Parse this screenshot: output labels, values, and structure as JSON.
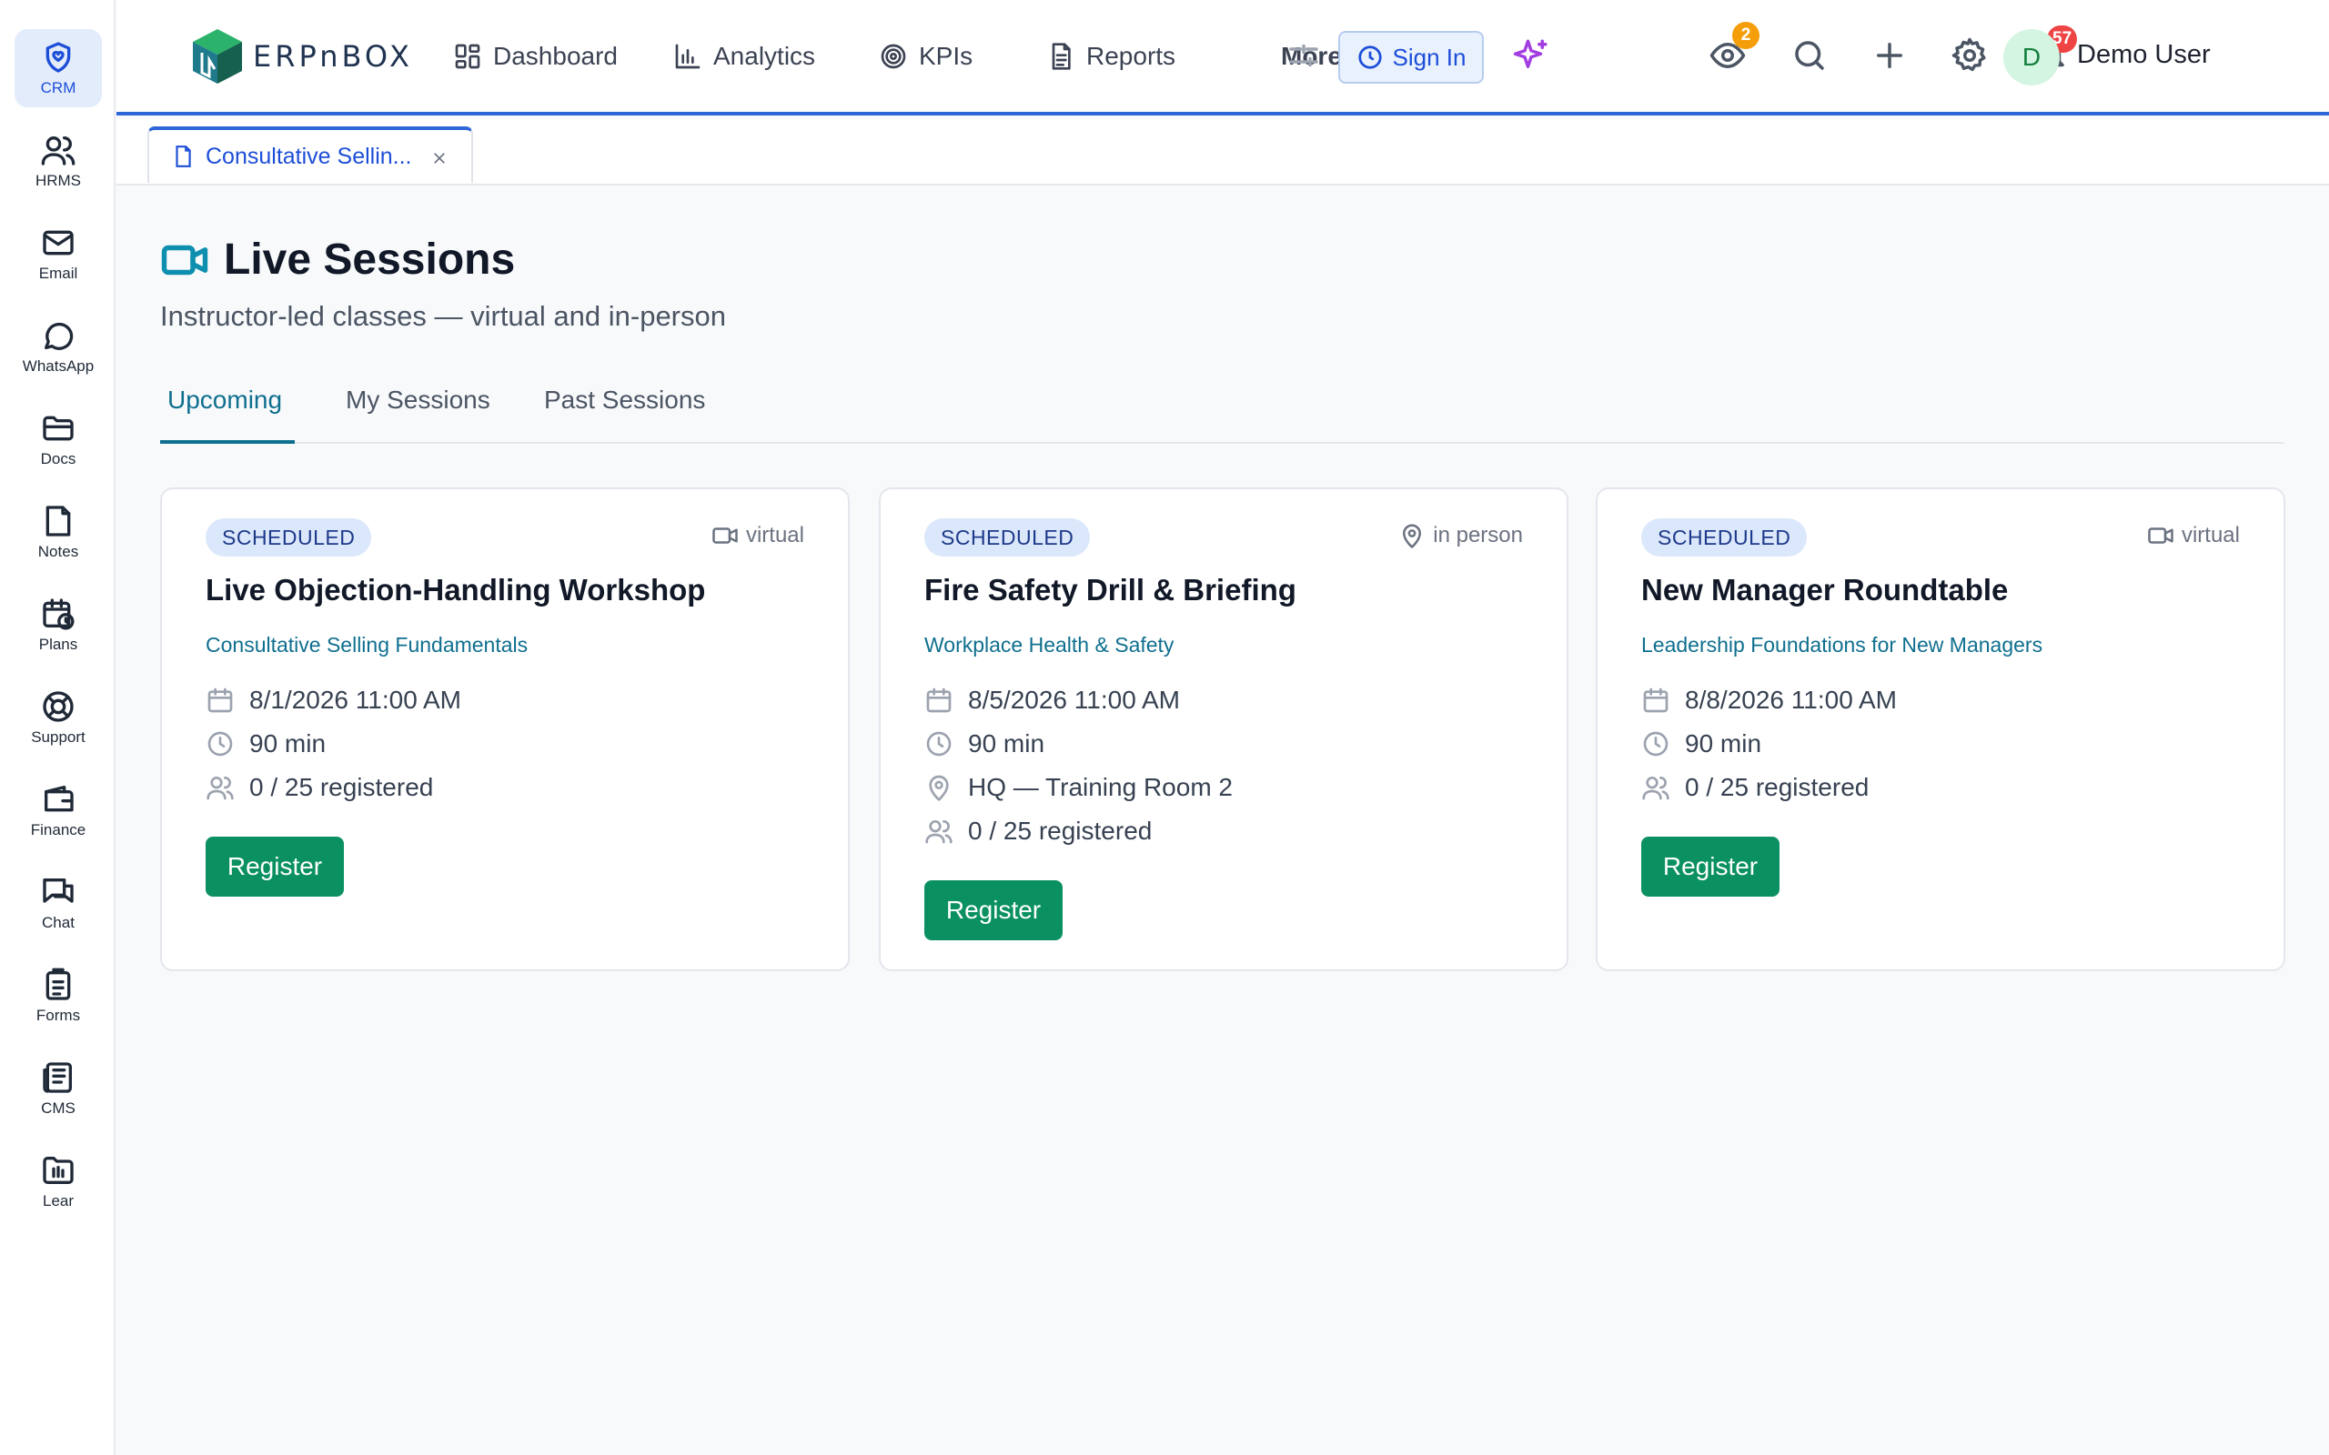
{
  "rail": [
    {
      "label": "CRM",
      "icon": "shield-heart-icon",
      "active": true
    },
    {
      "label": "HRMS",
      "icon": "users-icon"
    },
    {
      "label": "Email",
      "icon": "mail-icon"
    },
    {
      "label": "WhatsApp",
      "icon": "chat-bubble-icon"
    },
    {
      "label": "Docs",
      "icon": "folder-icon"
    },
    {
      "label": "Notes",
      "icon": "note-icon"
    },
    {
      "label": "Plans",
      "icon": "calendar-clock-icon"
    },
    {
      "label": "Support",
      "icon": "lifebuoy-icon"
    },
    {
      "label": "Finance",
      "icon": "wallet-icon"
    },
    {
      "label": "Chat",
      "icon": "messages-icon"
    },
    {
      "label": "Forms",
      "icon": "clipboard-icon"
    },
    {
      "label": "CMS",
      "icon": "newspaper-icon"
    },
    {
      "label": "Lear",
      "icon": "learning-folder-icon"
    }
  ],
  "topbar": {
    "logo_text": "ERPnBOX",
    "nav": {
      "dashboard": "Dashboard",
      "analytics": "Analytics",
      "kpis": "KPIs",
      "reports": "Reports",
      "more": "More"
    },
    "sign_in": "Sign In",
    "watch_count": "2",
    "notification_count": "57",
    "user_initial": "D",
    "user_name": "Demo User"
  },
  "doc_tab": {
    "label": "Consultative Sellin..."
  },
  "page": {
    "title": "Live Sessions",
    "subtitle": "Instructor-led classes — virtual and in-person",
    "tabs": [
      "Upcoming",
      "My Sessions",
      "Past Sessions"
    ],
    "active_tab": "Upcoming"
  },
  "sessions": [
    {
      "status": "SCHEDULED",
      "mode": "virtual",
      "title": "Live Objection-Handling Workshop",
      "course": "Consultative Selling Fundamentals",
      "datetime": "8/1/2026 11:00 AM",
      "duration": "90 min",
      "registered": "0 / 25 registered",
      "action": "Register"
    },
    {
      "status": "SCHEDULED",
      "mode": "in person",
      "title": "Fire Safety Drill & Briefing",
      "course": "Workplace Health & Safety",
      "datetime": "8/5/2026 11:00 AM",
      "duration": "90 min",
      "location": "HQ — Training Room 2",
      "registered": "0 / 25 registered",
      "action": "Register"
    },
    {
      "status": "SCHEDULED",
      "mode": "virtual",
      "title": "New Manager Roundtable",
      "course": "Leadership Foundations for New Managers",
      "datetime": "8/8/2026 11:00 AM",
      "duration": "90 min",
      "registered": "0 / 25 registered",
      "action": "Register"
    }
  ],
  "colors": {
    "accent": "#2f66d8",
    "teal": "#0f6f8f",
    "register": "#0b9161",
    "badge_orange": "#f59e0b",
    "badge_red": "#ef4444"
  }
}
